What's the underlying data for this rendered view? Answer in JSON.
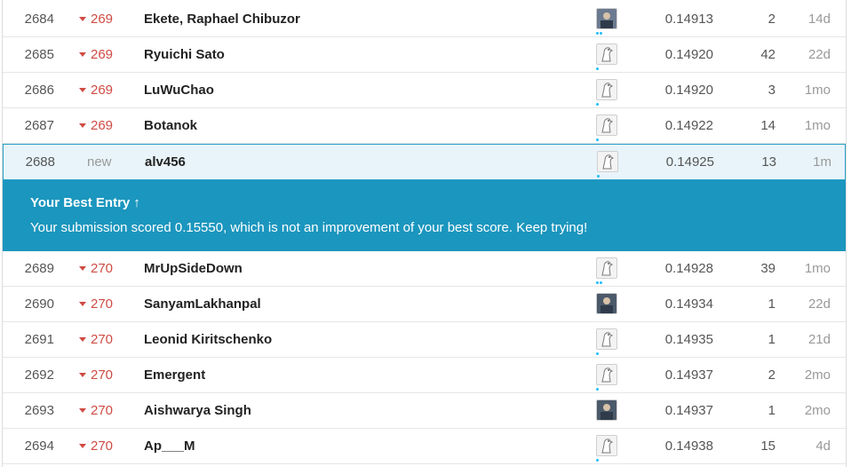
{
  "rows_above": [
    {
      "rank": "2684",
      "delta": "269",
      "name": "Ekete, Raphael Chibuzor",
      "avatar": "photo-icon",
      "dots": 2,
      "score": "0.14913",
      "entries": "2",
      "last": "14d"
    },
    {
      "rank": "2685",
      "delta": "269",
      "name": "Ryuichi Sato",
      "avatar": "goose-icon",
      "dots": 1,
      "score": "0.14920",
      "entries": "42",
      "last": "22d"
    },
    {
      "rank": "2686",
      "delta": "269",
      "name": "LuWuChao",
      "avatar": "goose-icon",
      "dots": 1,
      "score": "0.14920",
      "entries": "3",
      "last": "1mo"
    },
    {
      "rank": "2687",
      "delta": "269",
      "name": "Botanok",
      "avatar": "goose-icon",
      "dots": 1,
      "score": "0.14922",
      "entries": "14",
      "last": "1mo"
    }
  ],
  "me": {
    "rank": "2688",
    "delta": "new",
    "name": "alv456",
    "avatar": "goose-icon",
    "dots": 1,
    "score": "0.14925",
    "entries": "13",
    "last": "1m"
  },
  "banner": {
    "title": "Your Best Entry",
    "arrow": "↑",
    "message": "Your submission scored 0.15550, which is not an improvement of your best score. Keep trying!"
  },
  "rows_below": [
    {
      "rank": "2689",
      "delta": "270",
      "name": "MrUpSideDown",
      "avatar": "goose-icon",
      "dots": 2,
      "score": "0.14928",
      "entries": "39",
      "last": "1mo"
    },
    {
      "rank": "2690",
      "delta": "270",
      "name": "SanyamLakhanpal",
      "avatar": "photo-icon",
      "dots": 0,
      "score": "0.14934",
      "entries": "1",
      "last": "22d"
    },
    {
      "rank": "2691",
      "delta": "270",
      "name": "Leonid Kiritschenko",
      "avatar": "goose-icon",
      "dots": 1,
      "score": "0.14935",
      "entries": "1",
      "last": "21d"
    },
    {
      "rank": "2692",
      "delta": "270",
      "name": "Emergent",
      "avatar": "goose-icon",
      "dots": 1,
      "score": "0.14937",
      "entries": "2",
      "last": "2mo"
    },
    {
      "rank": "2693",
      "delta": "270",
      "name": "Aishwarya Singh",
      "avatar": "photo-icon",
      "dots": 0,
      "score": "0.14937",
      "entries": "1",
      "last": "2mo"
    },
    {
      "rank": "2694",
      "delta": "270",
      "name": "Ap___M",
      "avatar": "goose-icon",
      "dots": 1,
      "score": "0.14938",
      "entries": "15",
      "last": "4d"
    }
  ],
  "colors": {
    "accent": "#1b96be",
    "down": "#cf4b43",
    "dot": "#20beff"
  }
}
